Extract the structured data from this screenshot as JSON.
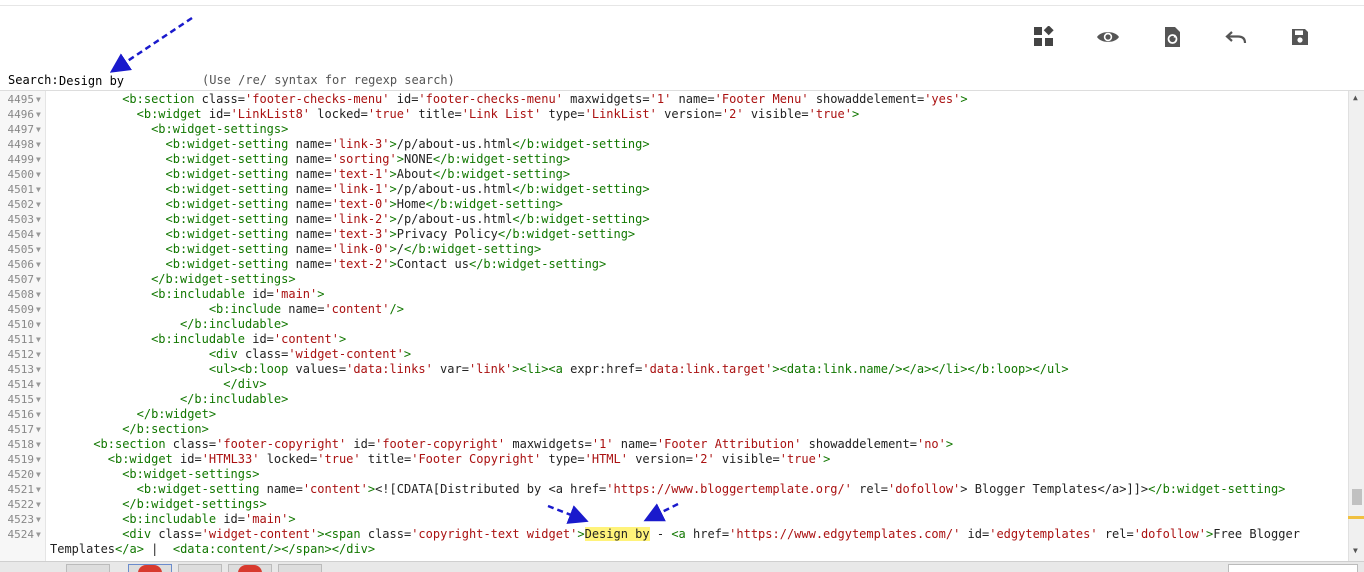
{
  "toolbar": {
    "buttons": [
      {
        "name": "widgets-button",
        "icon": "widgets-icon"
      },
      {
        "name": "preview-button",
        "icon": "eye-icon"
      },
      {
        "name": "restore-button",
        "icon": "file-refresh-icon"
      },
      {
        "name": "undo-button",
        "icon": "undo-icon"
      },
      {
        "name": "save-button",
        "icon": "save-disk-icon"
      }
    ]
  },
  "search": {
    "label": "Search:",
    "value": "Design by",
    "hint": "(Use /re/ syntax for regexp search)"
  },
  "editor": {
    "lines": [
      {
        "n": "4495",
        "indent": 10,
        "html": "<span class=\"tag\">&lt;b:section</span> class=<span class=\"str\">'footer-checks-menu'</span> id=<span class=\"str\">'footer-checks-menu'</span> maxwidgets=<span class=\"str\">'1'</span> name=<span class=\"str\">'Footer Menu'</span> showaddelement=<span class=\"str\">'yes'</span><span class=\"tag\">&gt;</span>"
      },
      {
        "n": "4496",
        "indent": 12,
        "html": "<span class=\"tag\">&lt;b:widget</span> id=<span class=\"str\">'LinkList8'</span> locked=<span class=\"str\">'true'</span> title=<span class=\"str\">'Link List'</span> type=<span class=\"str\">'LinkList'</span> version=<span class=\"str\">'2'</span> visible=<span class=\"str\">'true'</span><span class=\"tag\">&gt;</span>"
      },
      {
        "n": "4497",
        "indent": 14,
        "html": "<span class=\"tag\">&lt;b:widget-settings&gt;</span>"
      },
      {
        "n": "4498",
        "indent": 16,
        "html": "<span class=\"tag\">&lt;b:widget-setting</span> name=<span class=\"str\">'link-3'</span><span class=\"tag\">&gt;</span>/p/about-us.html<span class=\"tag\">&lt;/b:widget-setting&gt;</span>"
      },
      {
        "n": "4499",
        "indent": 16,
        "html": "<span class=\"tag\">&lt;b:widget-setting</span> name=<span class=\"str\">'sorting'</span><span class=\"tag\">&gt;</span>NONE<span class=\"tag\">&lt;/b:widget-setting&gt;</span>"
      },
      {
        "n": "4500",
        "indent": 16,
        "html": "<span class=\"tag\">&lt;b:widget-setting</span> name=<span class=\"str\">'text-1'</span><span class=\"tag\">&gt;</span>About<span class=\"tag\">&lt;/b:widget-setting&gt;</span>"
      },
      {
        "n": "4501",
        "indent": 16,
        "html": "<span class=\"tag\">&lt;b:widget-setting</span> name=<span class=\"str\">'link-1'</span><span class=\"tag\">&gt;</span>/p/about-us.html<span class=\"tag\">&lt;/b:widget-setting&gt;</span>"
      },
      {
        "n": "4502",
        "indent": 16,
        "html": "<span class=\"tag\">&lt;b:widget-setting</span> name=<span class=\"str\">'text-0'</span><span class=\"tag\">&gt;</span>Home<span class=\"tag\">&lt;/b:widget-setting&gt;</span>"
      },
      {
        "n": "4503",
        "indent": 16,
        "html": "<span class=\"tag\">&lt;b:widget-setting</span> name=<span class=\"str\">'link-2'</span><span class=\"tag\">&gt;</span>/p/about-us.html<span class=\"tag\">&lt;/b:widget-setting&gt;</span>"
      },
      {
        "n": "4504",
        "indent": 16,
        "html": "<span class=\"tag\">&lt;b:widget-setting</span> name=<span class=\"str\">'text-3'</span><span class=\"tag\">&gt;</span>Privacy Policy<span class=\"tag\">&lt;/b:widget-setting&gt;</span>"
      },
      {
        "n": "4505",
        "indent": 16,
        "html": "<span class=\"tag\">&lt;b:widget-setting</span> name=<span class=\"str\">'link-0'</span><span class=\"tag\">&gt;</span>/<span class=\"tag\">&lt;/b:widget-setting&gt;</span>"
      },
      {
        "n": "4506",
        "indent": 16,
        "html": "<span class=\"tag\">&lt;b:widget-setting</span> name=<span class=\"str\">'text-2'</span><span class=\"tag\">&gt;</span>Contact us<span class=\"tag\">&lt;/b:widget-setting&gt;</span>"
      },
      {
        "n": "4507",
        "indent": 14,
        "html": "<span class=\"tag\">&lt;/b:widget-settings&gt;</span>"
      },
      {
        "n": "4508",
        "indent": 14,
        "html": "<span class=\"tag\">&lt;b:includable</span> id=<span class=\"str\">'main'</span><span class=\"tag\">&gt;</span>"
      },
      {
        "n": "4509",
        "indent": 22,
        "html": "<span class=\"tag\">&lt;b:include</span> name=<span class=\"str\">'content'</span><span class=\"tag\">/&gt;</span>"
      },
      {
        "n": "4510",
        "indent": 18,
        "html": "<span class=\"tag\">&lt;/b:includable&gt;</span>"
      },
      {
        "n": "4511",
        "indent": 14,
        "html": "<span class=\"tag\">&lt;b:includable</span> id=<span class=\"str\">'content'</span><span class=\"tag\">&gt;</span>"
      },
      {
        "n": "4512",
        "indent": 22,
        "html": "<span class=\"tag\">&lt;div</span> class=<span class=\"str\">'widget-content'</span><span class=\"tag\">&gt;</span>"
      },
      {
        "n": "4513",
        "indent": 22,
        "html": "<span class=\"tag\">&lt;ul&gt;&lt;b:loop</span> values=<span class=\"str\">'data:links'</span> var=<span class=\"str\">'link'</span><span class=\"tag\">&gt;&lt;li&gt;&lt;a</span> expr:href=<span class=\"str\">'data:link.target'</span><span class=\"tag\">&gt;&lt;data:link.name/&gt;&lt;/a&gt;&lt;/li&gt;&lt;/b:loop&gt;&lt;/ul&gt;</span>"
      },
      {
        "n": "4514",
        "indent": 24,
        "html": "<span class=\"tag\">&lt;/div&gt;</span>"
      },
      {
        "n": "4515",
        "indent": 18,
        "html": "<span class=\"tag\">&lt;/b:includable&gt;</span>"
      },
      {
        "n": "4516",
        "indent": 12,
        "html": "<span class=\"tag\">&lt;/b:widget&gt;</span>"
      },
      {
        "n": "4517",
        "indent": 10,
        "html": "<span class=\"tag\">&lt;/b:section&gt;</span>"
      },
      {
        "n": "4518",
        "indent": 6,
        "html": "<span class=\"tag\">&lt;b:section</span> class=<span class=\"str\">'footer-copyright'</span> id=<span class=\"str\">'footer-copyright'</span> maxwidgets=<span class=\"str\">'1'</span> name=<span class=\"str\">'Footer Attribution'</span> showaddelement=<span class=\"str\">'no'</span><span class=\"tag\">&gt;</span>"
      },
      {
        "n": "4519",
        "indent": 8,
        "html": "<span class=\"tag\">&lt;b:widget</span> id=<span class=\"str\">'HTML33'</span> locked=<span class=\"str\">'true'</span> title=<span class=\"str\">'Footer Copyright'</span> type=<span class=\"str\">'HTML'</span> version=<span class=\"str\">'2'</span> visible=<span class=\"str\">'true'</span><span class=\"tag\">&gt;</span>"
      },
      {
        "n": "4520",
        "indent": 10,
        "html": "<span class=\"tag\">&lt;b:widget-settings&gt;</span>"
      },
      {
        "n": "4521",
        "indent": 12,
        "html": "<span class=\"tag\">&lt;b:widget-setting</span> name=<span class=\"str\">'content'</span><span class=\"tag\">&gt;</span>&lt;![CDATA[Distributed by &lt;a href=<span class=\"str\">'https://www.bloggertemplate.org/'</span> rel=<span class=\"str\">'dofollow'</span>&gt; Blogger Templates&lt;/a&gt;]]&gt;<span class=\"tag\">&lt;/b:widget-setting&gt;</span>"
      },
      {
        "n": "4522",
        "indent": 10,
        "html": "<span class=\"tag\">&lt;/b:widget-settings&gt;</span>"
      },
      {
        "n": "4523",
        "indent": 10,
        "html": "<span class=\"tag\">&lt;b:includable</span> id=<span class=\"str\">'main'</span><span class=\"tag\">&gt;</span>"
      },
      {
        "n": "4524",
        "indent": 10,
        "html": "<span class=\"tag\">&lt;div</span> class=<span class=\"str\">'widget-content'</span><span class=\"tag\">&gt;&lt;span</span> class=<span class=\"str\">'copyright-text widget'</span><span class=\"tag\">&gt;</span><span class=\"hl\">Design by</span> - <span class=\"tag\">&lt;a</span> href=<span class=\"str\">'https://www.edgytemplates.com/'</span> id=<span class=\"str\">'edgytemplates'</span> rel=<span class=\"str\">'dofollow'</span><span class=\"tag\">&gt;</span>Free Blogger"
      },
      {
        "n": "",
        "indent": 0,
        "html": "Templates<span class=\"tag\">&lt;/a&gt;</span> |  <span class=\"tag\">&lt;data:content/&gt;&lt;/span&gt;&lt;/div&gt;</span>"
      }
    ]
  },
  "colors": {
    "tag": "#117700",
    "string": "#aa1111",
    "highlight": "#fff37a",
    "annotation_arrow": "#1a1acc"
  }
}
